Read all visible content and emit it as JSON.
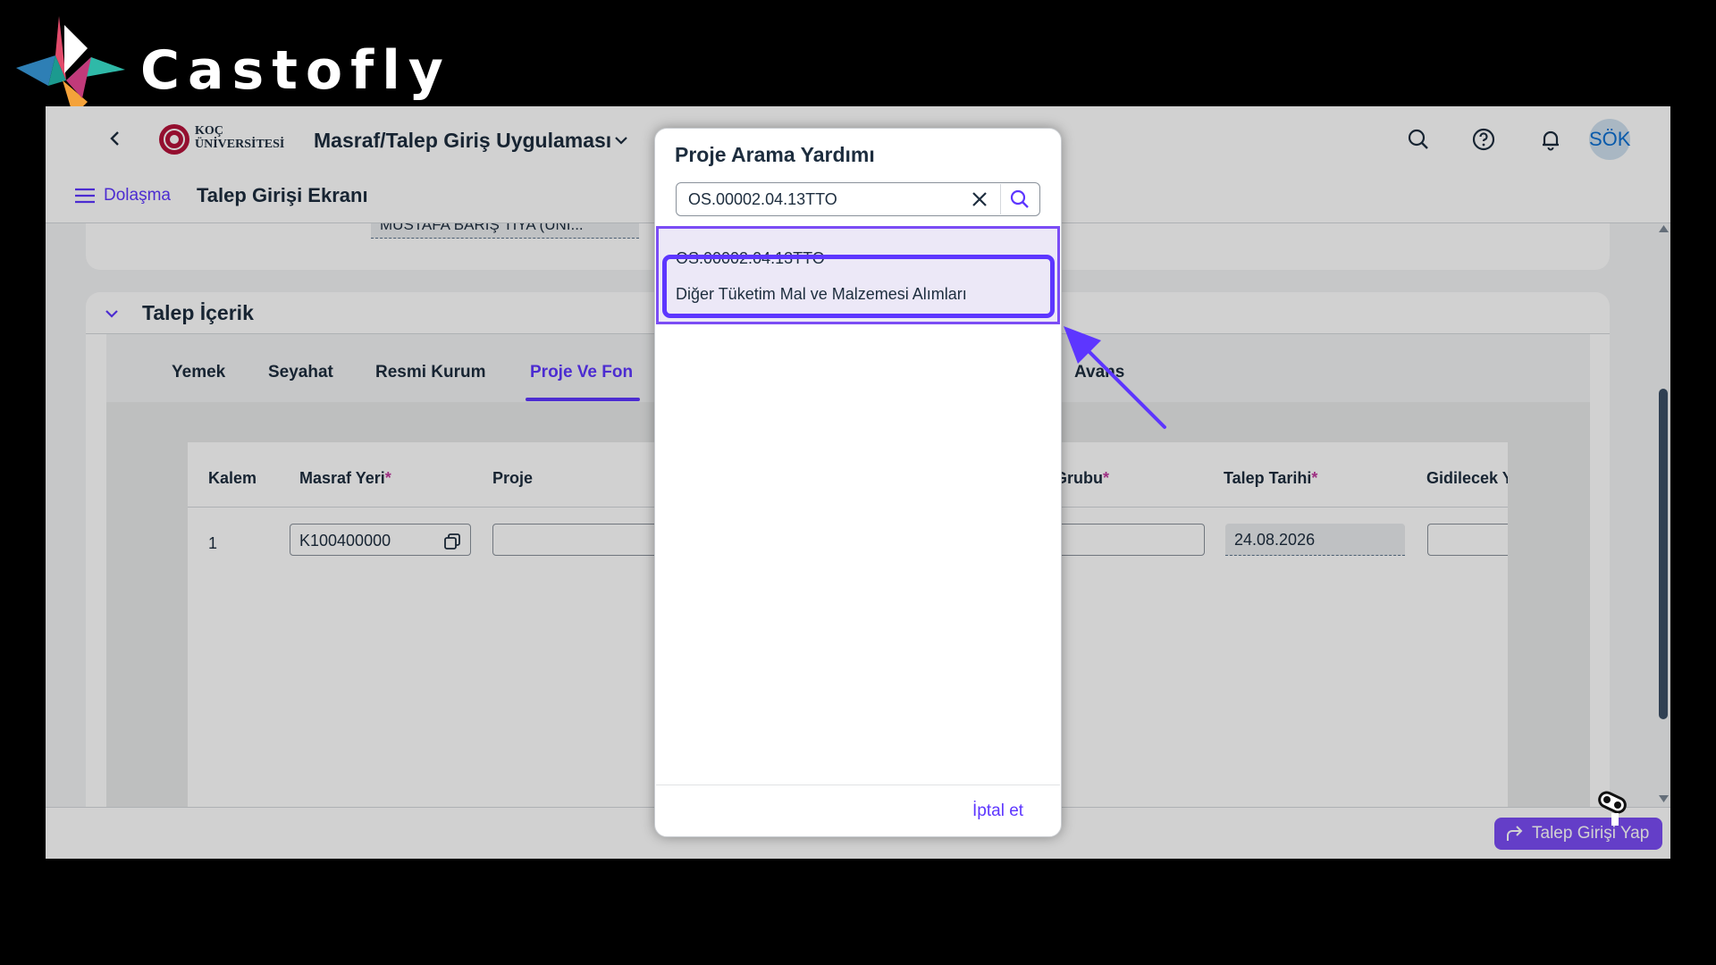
{
  "brand": {
    "name": "Castofly"
  },
  "shell": {
    "logo_text_1": "KOÇ",
    "logo_text_2": "ÜNİVERSİTESİ",
    "app_title": "Masraf/Talep Giriş Uygulaması",
    "avatar": "SÖK",
    "nav_link": "Dolaşma",
    "screen_title": "Talep Girişi Ekranı"
  },
  "panel_top": {
    "field_value": "MUSTAFA BARIŞ TİYA (ÜNİ..."
  },
  "section": {
    "title": "Talep İçerik",
    "tabs": [
      "Yemek",
      "Seyahat",
      "Resmi Kurum",
      "Proje Ve Fon",
      "Avans"
    ],
    "active_tab": "Proje Ve Fon"
  },
  "table": {
    "headers": {
      "kalem": "Kalem",
      "masraf_yeri": "Masraf Yeri",
      "proje": "Proje",
      "grubu": "Grubu",
      "talep_tarihi": "Talep Tarihi",
      "gidilecek": "Gidilecek Y"
    },
    "required_mark": "*",
    "row": {
      "kalem": "1",
      "masraf_yeri": "K100400000",
      "talep_tarihi": "24.08.2026"
    }
  },
  "footer": {
    "primary_button": "Talep Girişi Yap"
  },
  "dialog": {
    "title": "Proje Arama Yardımı",
    "search_value": "OS.00002.04.13TTO",
    "result": {
      "title": "OS.00002.04.13TTO",
      "description": "Diğer Tüketim Mal ve Malzemesi Alımları"
    },
    "cancel": "İptal et"
  },
  "colors": {
    "accent": "#5d36ff",
    "primary_button": "#7b4cf5",
    "selection": "#ece8f7"
  }
}
